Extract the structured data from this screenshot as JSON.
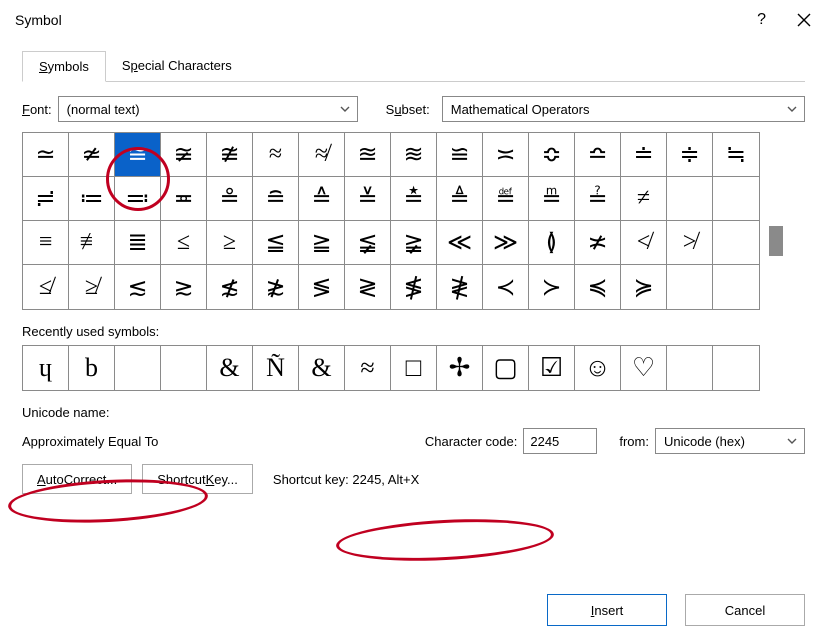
{
  "title": "Symbol",
  "tabs": {
    "symbols": "Symbols",
    "special": "Special Characters"
  },
  "labels": {
    "font": "Font:",
    "subset": "Subset:",
    "recent": "Recently used symbols:",
    "unicode_name": "Unicode name:",
    "char_code": "Character code:",
    "from": "from:"
  },
  "font_value": "(normal text)",
  "subset_value": "Mathematical Operators",
  "grid": [
    [
      "≃",
      "≄",
      "≅",
      "≆",
      "≇",
      "≈",
      "≉",
      "≊",
      "≋",
      "≌",
      "≍",
      "≎",
      "≏",
      "≐",
      "≑",
      "≒"
    ],
    [
      "≓",
      "≔",
      "≕",
      "≖",
      "≗",
      "≘",
      "≙",
      "≚",
      "≛",
      "≜",
      "≝",
      "≞",
      "≟",
      "≠",
      "",
      ""
    ],
    [
      "≡",
      "≢",
      "≣",
      "≤",
      "≥",
      "≦",
      "≧",
      "≨",
      "≩",
      "≪",
      "≫",
      "≬",
      "≭",
      "≮",
      "≯",
      ""
    ],
    [
      "≰",
      "≱",
      "≲",
      "≳",
      "≴",
      "≵",
      "≶",
      "≷",
      "≸",
      "≹",
      "≺",
      "≻",
      "≼",
      "≽",
      "",
      ""
    ]
  ],
  "selected_index": [
    0,
    2
  ],
  "recent": [
    "ɥ",
    "b",
    "",
    "",
    "&",
    "Ñ",
    "&",
    "≈",
    "□",
    "✢",
    "▢",
    "☑",
    "☺",
    "♡",
    "",
    ""
  ],
  "unicode_name_value": "Approximately Equal To",
  "char_code_value": "2245",
  "from_value": "Unicode (hex)",
  "buttons": {
    "autocorrect": "AutoCorrect...",
    "shortcut": "Shortcut Key...",
    "shortcut_info": "Shortcut key: 2245, Alt+X",
    "insert": "Insert",
    "cancel": "Cancel"
  }
}
